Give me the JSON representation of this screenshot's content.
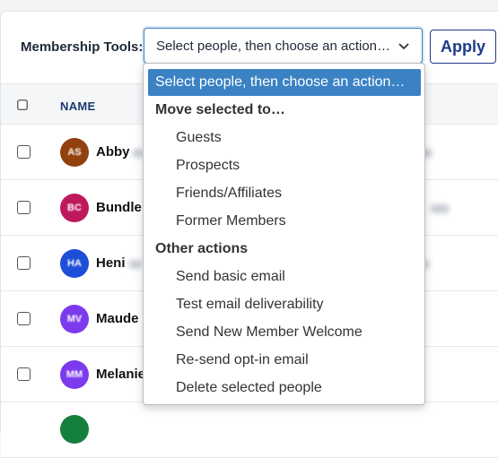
{
  "toolbar": {
    "label": "Membership Tools:",
    "select_value": "Select people, then choose an action…",
    "apply_label": "Apply"
  },
  "table": {
    "header_name": "NAME",
    "rows": [
      {
        "initials": "AS",
        "name": "Abby",
        "color": "#92400e"
      },
      {
        "initials": "BC",
        "name": "Bundle C",
        "color": "#be185d"
      },
      {
        "initials": "HA",
        "name": "Heni",
        "color": "#1d4ed8"
      },
      {
        "initials": "MV",
        "name": "Maude V",
        "color": "#7c3aed"
      },
      {
        "initials": "MM",
        "name": "Melanie",
        "color": "#7c3aed"
      },
      {
        "initials": "",
        "name": "",
        "color": "#15803d"
      }
    ]
  },
  "dropdown": {
    "selected": "Select people, then choose an action…",
    "group_move": "Move selected to…",
    "move_options": [
      "Guests",
      "Prospects",
      "Friends/Affiliates",
      "Former Members"
    ],
    "group_other": "Other actions",
    "other_options": [
      "Send basic email",
      "Test email deliverability",
      "Send New Member Welcome",
      "Re-send opt-in email",
      "Delete selected people"
    ]
  }
}
